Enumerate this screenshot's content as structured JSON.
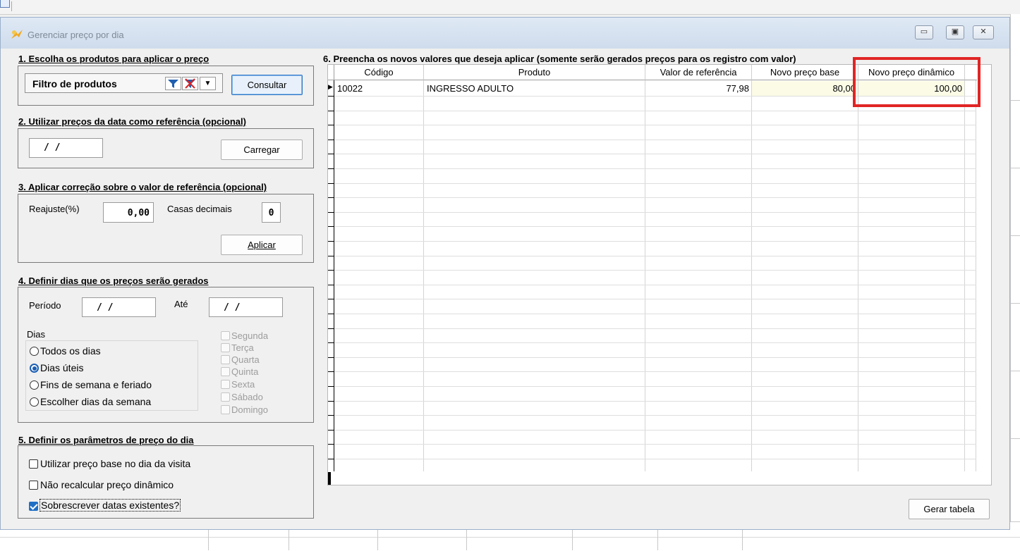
{
  "window": {
    "title": "Gerenciar preço por dia",
    "min_glyph": "▭",
    "max_glyph": "▣",
    "close_glyph": "✕"
  },
  "section1": {
    "title": "1. Escolha os produtos para aplicar o preço",
    "filter_label": "Filtro de produtos",
    "consult_button": "Consultar"
  },
  "section2": {
    "title": "2. Utilizar preços da data como referência (opcional)",
    "date_value": " /  /",
    "load_button": "Carregar"
  },
  "section3": {
    "title": "3. Aplicar correção sobre o valor de referência (opcional)",
    "adjust_label": "Reajuste(%)",
    "adjust_value": "0,00",
    "decimals_label": "Casas decimais",
    "decimals_value": "0",
    "apply_button": "Aplicar"
  },
  "section4": {
    "title": "4. Definir dias que os preços serão gerados",
    "period_label": "Período",
    "period_from": " /  /",
    "until_label": "Até",
    "period_to": " /  /",
    "days_label": "Dias",
    "radio_options": [
      "Todos os dias",
      "Dias úteis",
      "Fins de semana e feriado",
      "Escolher dias da semana"
    ],
    "selected_option": "Dias úteis",
    "weekdays": [
      "Segunda",
      "Terça",
      "Quarta",
      "Quinta",
      "Sexta",
      "Sábado",
      "Domingo"
    ]
  },
  "section5": {
    "title": "5. Definir os parâmetros de preço do dia",
    "options": [
      {
        "label": "Utilizar preço base no dia da visita",
        "checked": false
      },
      {
        "label": "Não recalcular preço dinâmico",
        "checked": false
      },
      {
        "label": "Sobrescrever datas existentes?",
        "checked": true
      }
    ]
  },
  "section6": {
    "title": "6. Preencha os novos valores que deseja aplicar (somente serão gerados preços para os registro com valor)",
    "columns": [
      "Código",
      "Produto",
      "Valor de referência",
      "Novo preço base",
      "Novo preço dinâmico"
    ],
    "rows": [
      {
        "codigo": "10022",
        "produto": "INGRESSO ADULTO",
        "valor_referencia": "77,98",
        "novo_preco_base": "80,00",
        "novo_preco_dinamico": "100,00"
      }
    ]
  },
  "footer": {
    "generate_button": "Gerar tabela"
  },
  "colors": {
    "highlight": "#e12525",
    "accent": "#1f6fc5",
    "editable_cell": "#fbfbe6"
  }
}
